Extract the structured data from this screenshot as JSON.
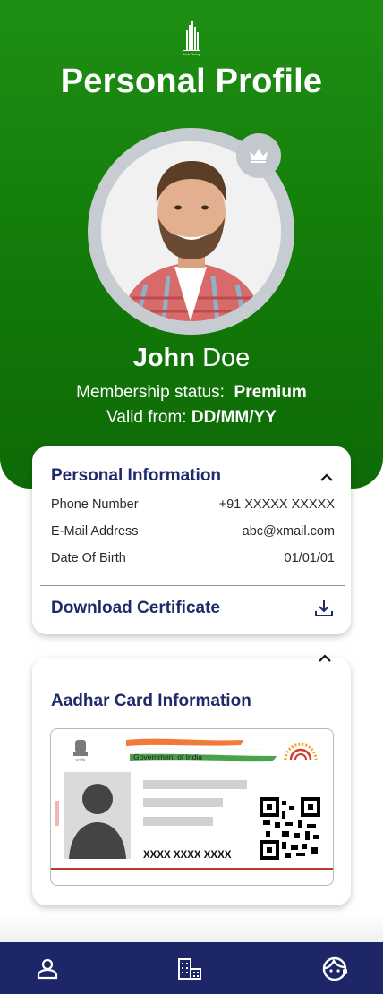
{
  "header": {
    "logo_text": "Acre Group",
    "title": "Personal Profile"
  },
  "profile": {
    "first_name": "John",
    "last_name": "Doe",
    "membership_label": "Membership status:",
    "membership_value": "Premium",
    "valid_label": "Valid from:",
    "valid_value": "DD/MM/YY"
  },
  "personal_info": {
    "title": "Personal Information",
    "rows": [
      {
        "label": "Phone Number",
        "value": "+91 XXXXX XXXXX"
      },
      {
        "label": "E-Mail Address",
        "value": "abc@xmail.com"
      },
      {
        "label": "Date Of Birth",
        "value": "01/01/01"
      }
    ],
    "download_label": "Download Certificate"
  },
  "aadhar": {
    "title": "Aadhar Card Information",
    "gov_text": "Government of India",
    "card_number": "XXXX XXXX XXXX"
  },
  "colors": {
    "header_green": "#127a09",
    "navy": "#1f2a6b",
    "nav_bg": "#1d2767"
  },
  "icons": [
    "crown-icon",
    "chevron-up-icon",
    "download-icon",
    "person-icon",
    "building-icon",
    "support-agent-icon"
  ]
}
